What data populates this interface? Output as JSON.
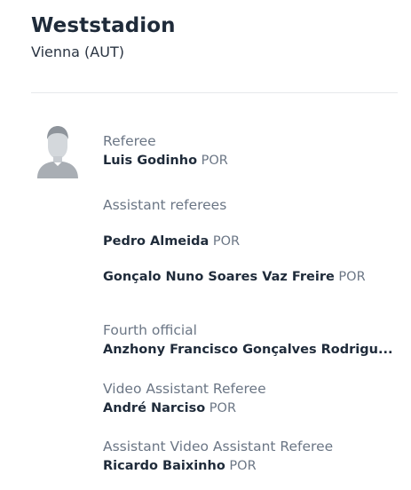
{
  "stadium": {
    "name": "Weststadion",
    "city": "Vienna (AUT)"
  },
  "officials": {
    "referee": {
      "role": "Referee",
      "name": "Luis Godinho",
      "country": "POR"
    },
    "assistants": {
      "role": "Assistant referees",
      "people": [
        {
          "name": "Pedro Almeida",
          "country": "POR"
        },
        {
          "name": "Gonçalo Nuno Soares Vaz Freire",
          "country": "POR"
        }
      ]
    },
    "fourth": {
      "role": "Fourth official",
      "name": "Anzhony Francisco Gonçalves Rodrigu...",
      "country": ""
    },
    "var": {
      "role": "Video Assistant Referee",
      "name": "André Narciso",
      "country": "POR"
    },
    "avar": {
      "role": "Assistant Video Assistant Referee",
      "name": "Ricardo Baixinho",
      "country": "POR"
    }
  },
  "colors": {
    "text_primary": "#1f2b3a",
    "text_secondary": "#6b7685",
    "avatar_fill": "#c4c8cd",
    "divider": "#e6e8eb"
  },
  "icons": {
    "avatar": "person-silhouette-icon"
  }
}
